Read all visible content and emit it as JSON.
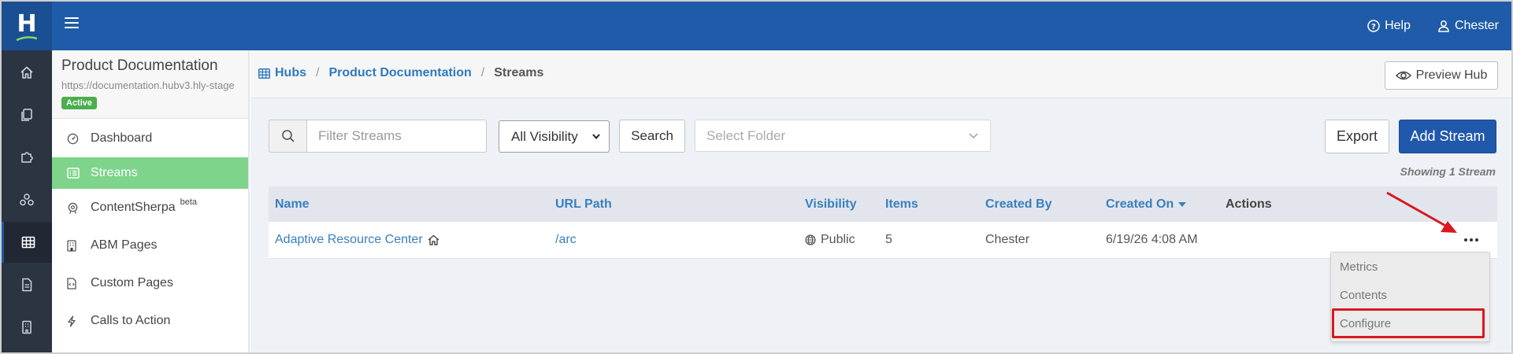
{
  "topbar": {
    "logo_letter": "H",
    "help_label": "Help",
    "user_label": "Chester"
  },
  "rail": {
    "items": [
      "home-icon",
      "copy-icon",
      "puzzle-icon",
      "network-icon",
      "table-icon",
      "document-icon",
      "building-icon"
    ],
    "active_index": 4
  },
  "sidebar": {
    "hub_title": "Product Documentation",
    "hub_url": "https://documentation.hubv3.hly-stage",
    "status_badge": "Active",
    "items": [
      {
        "label": "Dashboard",
        "icon": "dashboard-gauge-icon"
      },
      {
        "label": "Streams",
        "icon": "list-icon",
        "active": true
      },
      {
        "label": "ContentSherpa",
        "icon": "sherpa-icon",
        "tag": "beta"
      },
      {
        "label": "ABM Pages",
        "icon": "building-icon"
      },
      {
        "label": "Custom Pages",
        "icon": "code-file-icon"
      },
      {
        "label": "Calls to Action",
        "icon": "bolt-icon"
      }
    ]
  },
  "breadcrumb": {
    "items": [
      "Hubs",
      "Product Documentation"
    ],
    "current": "Streams"
  },
  "header": {
    "preview_label": "Preview Hub"
  },
  "filters": {
    "search_placeholder": "Filter Streams",
    "visibility_value": "All Visibility",
    "search_button": "Search",
    "folder_placeholder": "Select Folder"
  },
  "actions": {
    "export_label": "Export",
    "add_label": "Add Stream"
  },
  "showing_text": "Showing 1 Stream",
  "table": {
    "columns": [
      "Name",
      "URL Path",
      "Visibility",
      "Items",
      "Created By",
      "Created On",
      "Actions"
    ],
    "sorted_column": "Created On",
    "rows": [
      {
        "name": "Adaptive Resource Center",
        "url_path": "/arc",
        "visibility": "Public",
        "items": "5",
        "created_by": "Chester",
        "created_on": "6/19/26 4:08 AM"
      }
    ]
  },
  "actions_menu": {
    "items": [
      "Metrics",
      "Contents",
      "Configure"
    ],
    "highlighted": "Configure"
  },
  "colors": {
    "topbar": "#1f5ba8",
    "rail": "#2b3441",
    "active_nav": "#7ed48b",
    "primary_button": "#2058ab",
    "link": "#3a7fbf",
    "annotation": "#d9181f"
  }
}
